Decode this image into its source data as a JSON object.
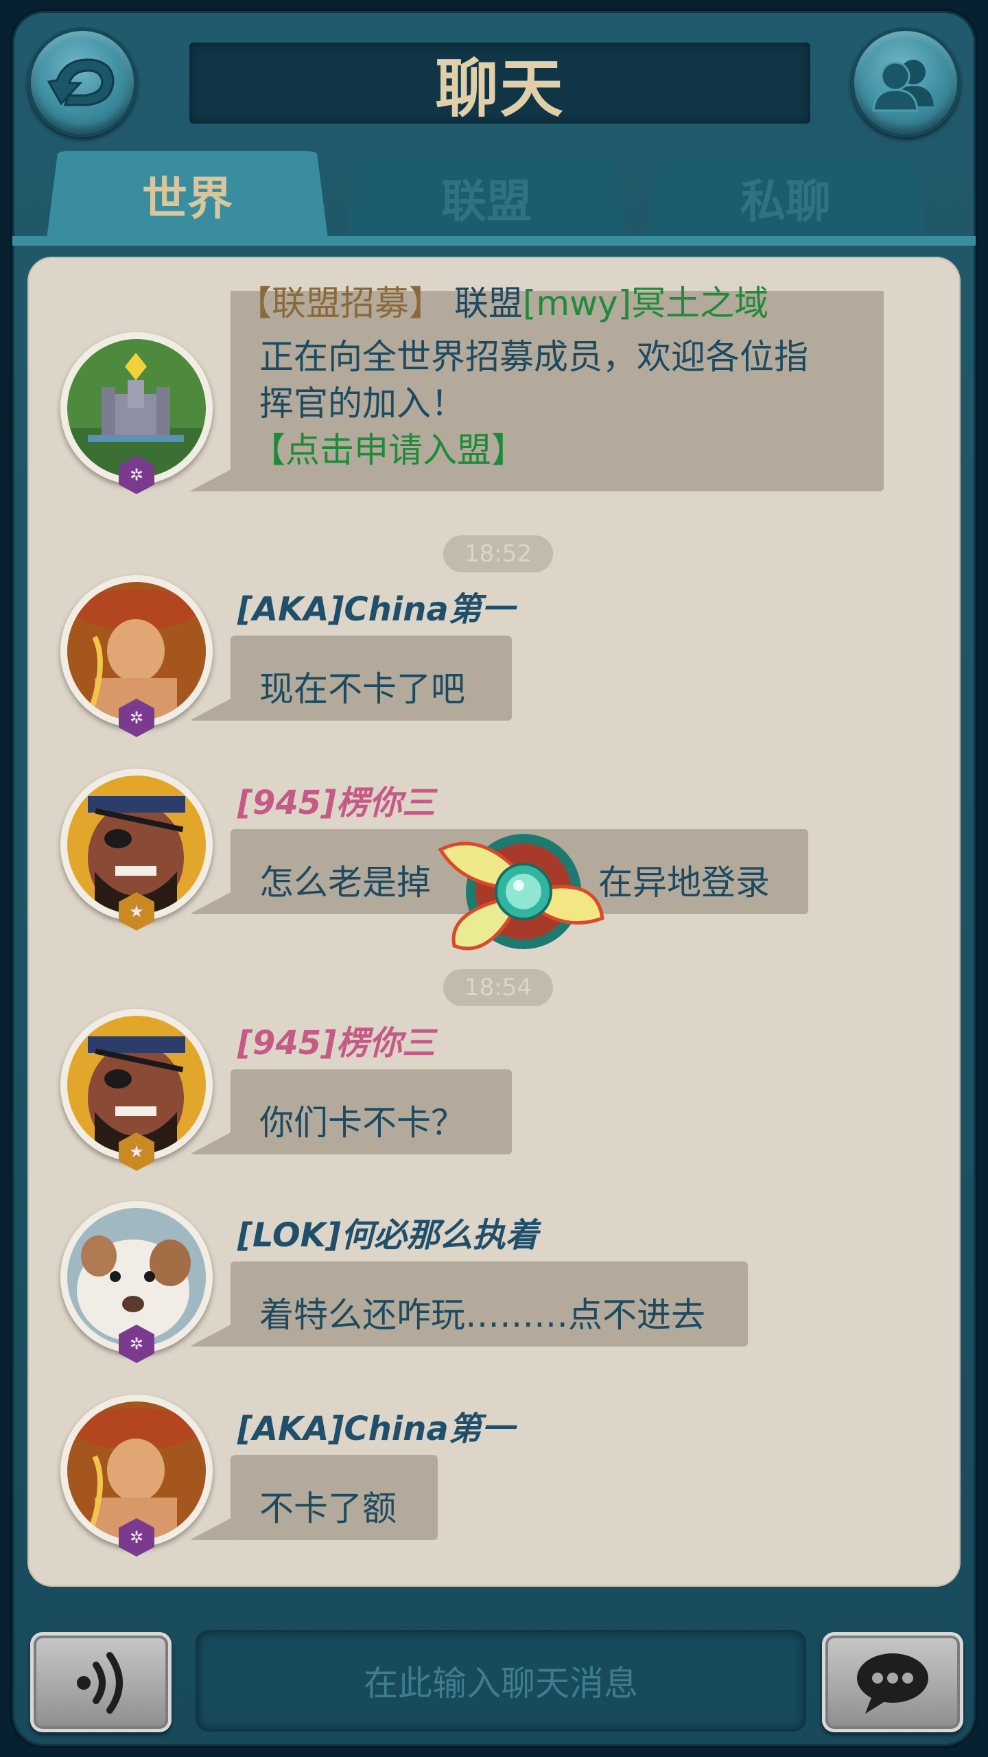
{
  "header": {
    "title": "聊天",
    "back_icon": "back-arrow-icon",
    "friends_icon": "friends-icon"
  },
  "tabs": [
    {
      "label": "世界",
      "active": true
    },
    {
      "label": "联盟",
      "active": false
    },
    {
      "label": "私聊",
      "active": false
    }
  ],
  "messages": {
    "recruit": {
      "tag": "【联盟招募】",
      "alliance_prefix": "联盟",
      "alliance_name": "[mwy]冥土之域",
      "line2": "正在向全世界招募成员，欢迎各位指",
      "line3": "挥官的加入！",
      "apply_link": "【点击申请入盟】"
    },
    "time1": "18:52",
    "m1": {
      "name": "[AKA]China第一",
      "text": "现在不卡了吧"
    },
    "m2": {
      "name": "[945]楞你三",
      "text_left": "怎么老是掉",
      "text_right": "在异地登录"
    },
    "time2": "18:54",
    "m3": {
      "name": "[945]楞你三",
      "text": "你们卡不卡？"
    },
    "m4": {
      "name": "[LOK]何必那么执着",
      "text": "着特么还咋玩………点不进去"
    },
    "m5": {
      "name": "[AKA]China第一",
      "text": "不卡了额"
    }
  },
  "footer": {
    "input_placeholder": "在此输入聊天消息",
    "voice_icon": "voice-icon",
    "send_icon": "chat-bubble-icon"
  },
  "colors": {
    "name_blue": "#1f4f6b",
    "name_pink": "#c65a86",
    "link_green": "#1f8a3a",
    "tab_active_text": "#d9c69c",
    "bubble": "#b3aa9b"
  }
}
